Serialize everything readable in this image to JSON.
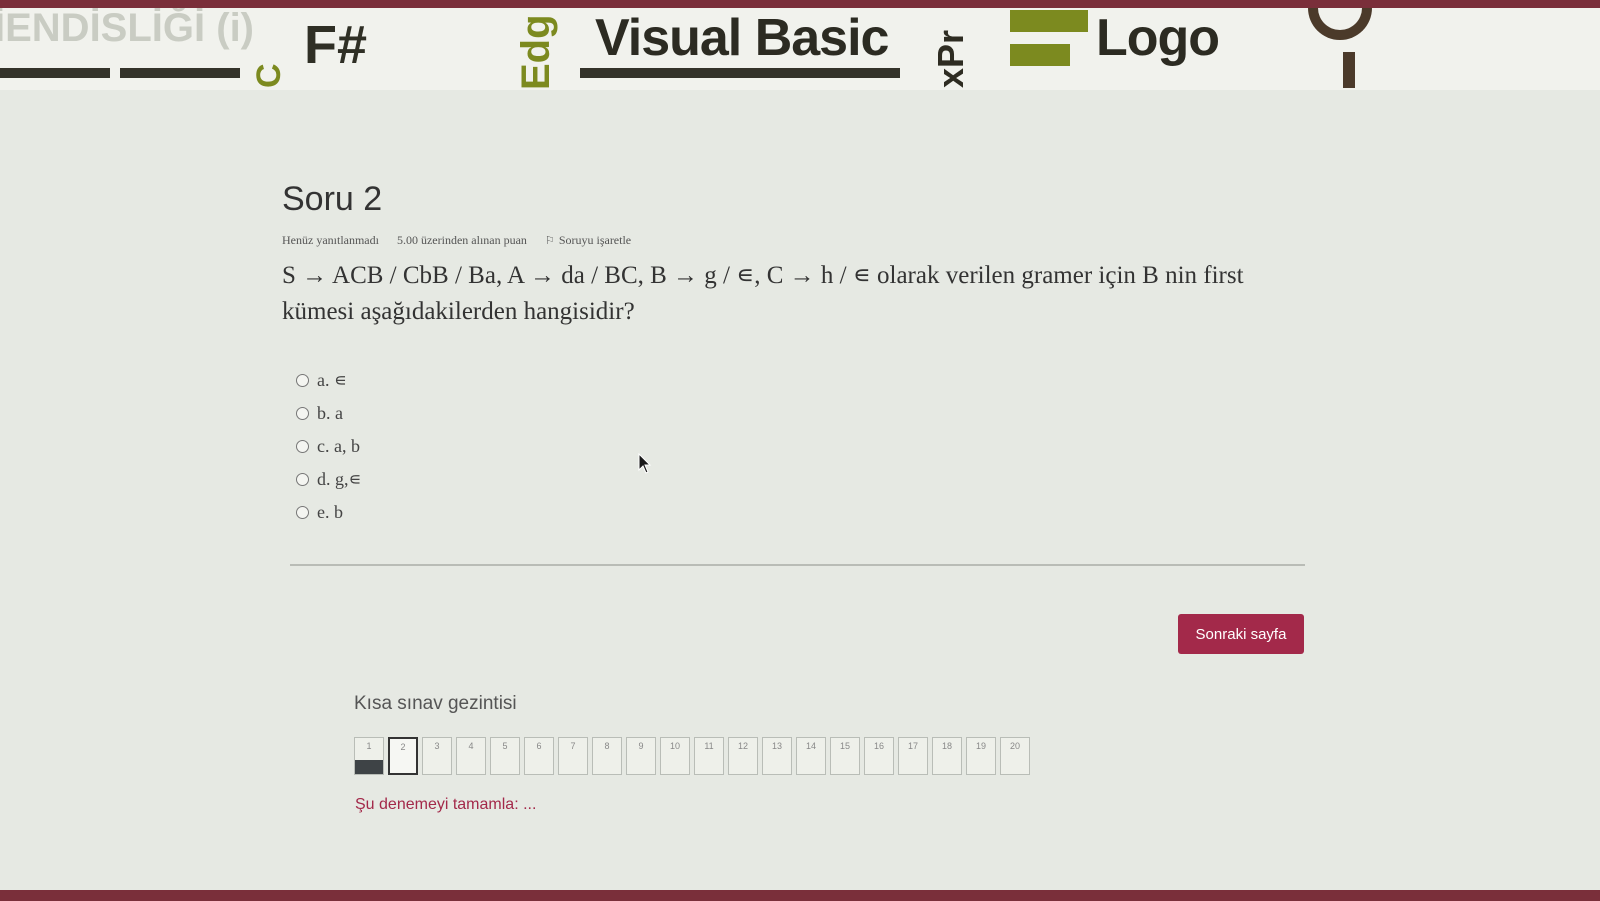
{
  "banner": {
    "words": [
      "İENDİSLİĞİ (i)",
      "F#",
      "Visual Basic",
      "Logo",
      "Edg",
      "C",
      "xPr"
    ]
  },
  "question": {
    "title": "Soru 2",
    "status": "Henüz yanıtlanmadı",
    "points": "5.00 üzerinden alınan puan",
    "flag_label": "Soruyu işaretle",
    "text": "S → ACB / CbB / Ba, A → da / BC, B → g / ∊, C → h / ∊ olarak verilen gramer için B nin first kümesi aşağıdakilerden hangisidir?",
    "options": [
      {
        "label": "a. ∊"
      },
      {
        "label": "b. a"
      },
      {
        "label": "c. a, b"
      },
      {
        "label": "d. g,∊"
      },
      {
        "label": "e. b"
      }
    ]
  },
  "next_button": "Sonraki sayfa",
  "quiz_nav": {
    "title": "Kısa sınav gezintisi",
    "pages": [
      "1",
      "2",
      "3",
      "4",
      "5",
      "6",
      "7",
      "8",
      "9",
      "10",
      "11",
      "12",
      "13",
      "14",
      "15",
      "16",
      "17",
      "18",
      "19",
      "20"
    ],
    "answered": [
      "1"
    ],
    "current": "2",
    "finish_link": "Şu denemeyi tamamla: ..."
  },
  "colors": {
    "accent": "#a3294a",
    "frame": "#7a2f3a",
    "olive": "#7c8a1f"
  }
}
